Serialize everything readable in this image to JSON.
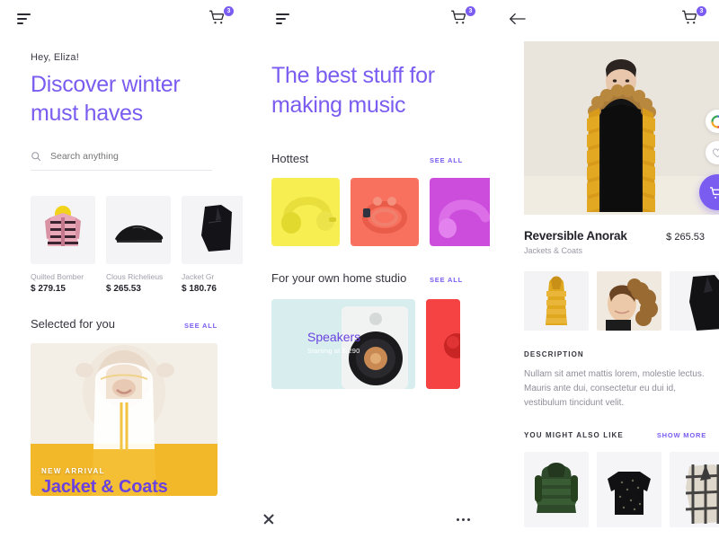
{
  "accent": "#7a5cf0",
  "screen_home": {
    "topbar": {
      "filter_icon": "filter-icon",
      "cart_icon": "cart-icon",
      "cart_badge": "3"
    },
    "greeting": "Hey, Eliza!",
    "hero_title": "Discover winter must haves",
    "search": {
      "placeholder": "Search anything",
      "value": "",
      "icon": "search-icon"
    },
    "products": [
      {
        "name": "Quilted Bomber",
        "price": "$ 279.15"
      },
      {
        "name": "Clous Richelieus",
        "price": "$ 265.53"
      },
      {
        "name": "Jacket Gr",
        "price": "$ 180.76"
      }
    ],
    "section": {
      "title": "Selected for you",
      "see_all": "SEE ALL"
    },
    "banner": {
      "kicker": "NEW ARRIVAL",
      "headline": "Jacket & Coats"
    }
  },
  "screen_music": {
    "topbar": {
      "filter_icon": "filter-icon",
      "cart_icon": "cart-icon",
      "cart_badge": "3"
    },
    "hero_title": "The best stuff for making music",
    "hottest": {
      "title": "Hottest",
      "see_all": "SEE ALL"
    },
    "hottest_tiles": [
      {
        "name": "yellow-headphones",
        "color": "#f7ee52"
      },
      {
        "name": "coral-earbuds",
        "color": "#f8715f"
      },
      {
        "name": "purple-headphones",
        "color": "#cc4ddb"
      }
    ],
    "studio": {
      "title": "For your own home studio",
      "see_all": "SEE ALL"
    },
    "studio_banner": {
      "title": "Speakers",
      "subtitle": "Starting at $ 290",
      "color": "#d8eeee"
    },
    "studio_side": {
      "name": "red-speaker-card",
      "color": "#f54242"
    },
    "bottombar": {
      "close_icon": "close-icon",
      "more_icon": "more-icon"
    }
  },
  "screen_product": {
    "topbar": {
      "back_icon": "back-arrow-icon",
      "cart_icon": "cart-icon",
      "cart_badge": "3"
    },
    "hero": {
      "name": "reversible-anorak-hero"
    },
    "actions": {
      "color_picker": "color-wheel-icon",
      "favorite": "heart-icon",
      "add_to_cart": "add-to-cart-icon"
    },
    "title": "Reversible Anorak",
    "price": "$ 265.53",
    "category": "Jackets & Coats",
    "gallery": [
      {
        "name": "anorak-yellow-full"
      },
      {
        "name": "anorak-fur-hood-detail"
      },
      {
        "name": "anorak-black-side"
      }
    ],
    "description": {
      "label": "DESCRIPTION",
      "body": "Nullam sit amet mattis lorem,  molestie lectus. Mauris ante dui, consectetur eu dui id, vestibulum tincidunt velit."
    },
    "also_like": {
      "label": "YOU MIGHT ALSO LIKE",
      "show_more": "SHOW MORE"
    },
    "also_like_items": [
      {
        "name": "green-puffer-jacket"
      },
      {
        "name": "black-dotted-blouse"
      },
      {
        "name": "plaid-checked-coat"
      }
    ]
  }
}
